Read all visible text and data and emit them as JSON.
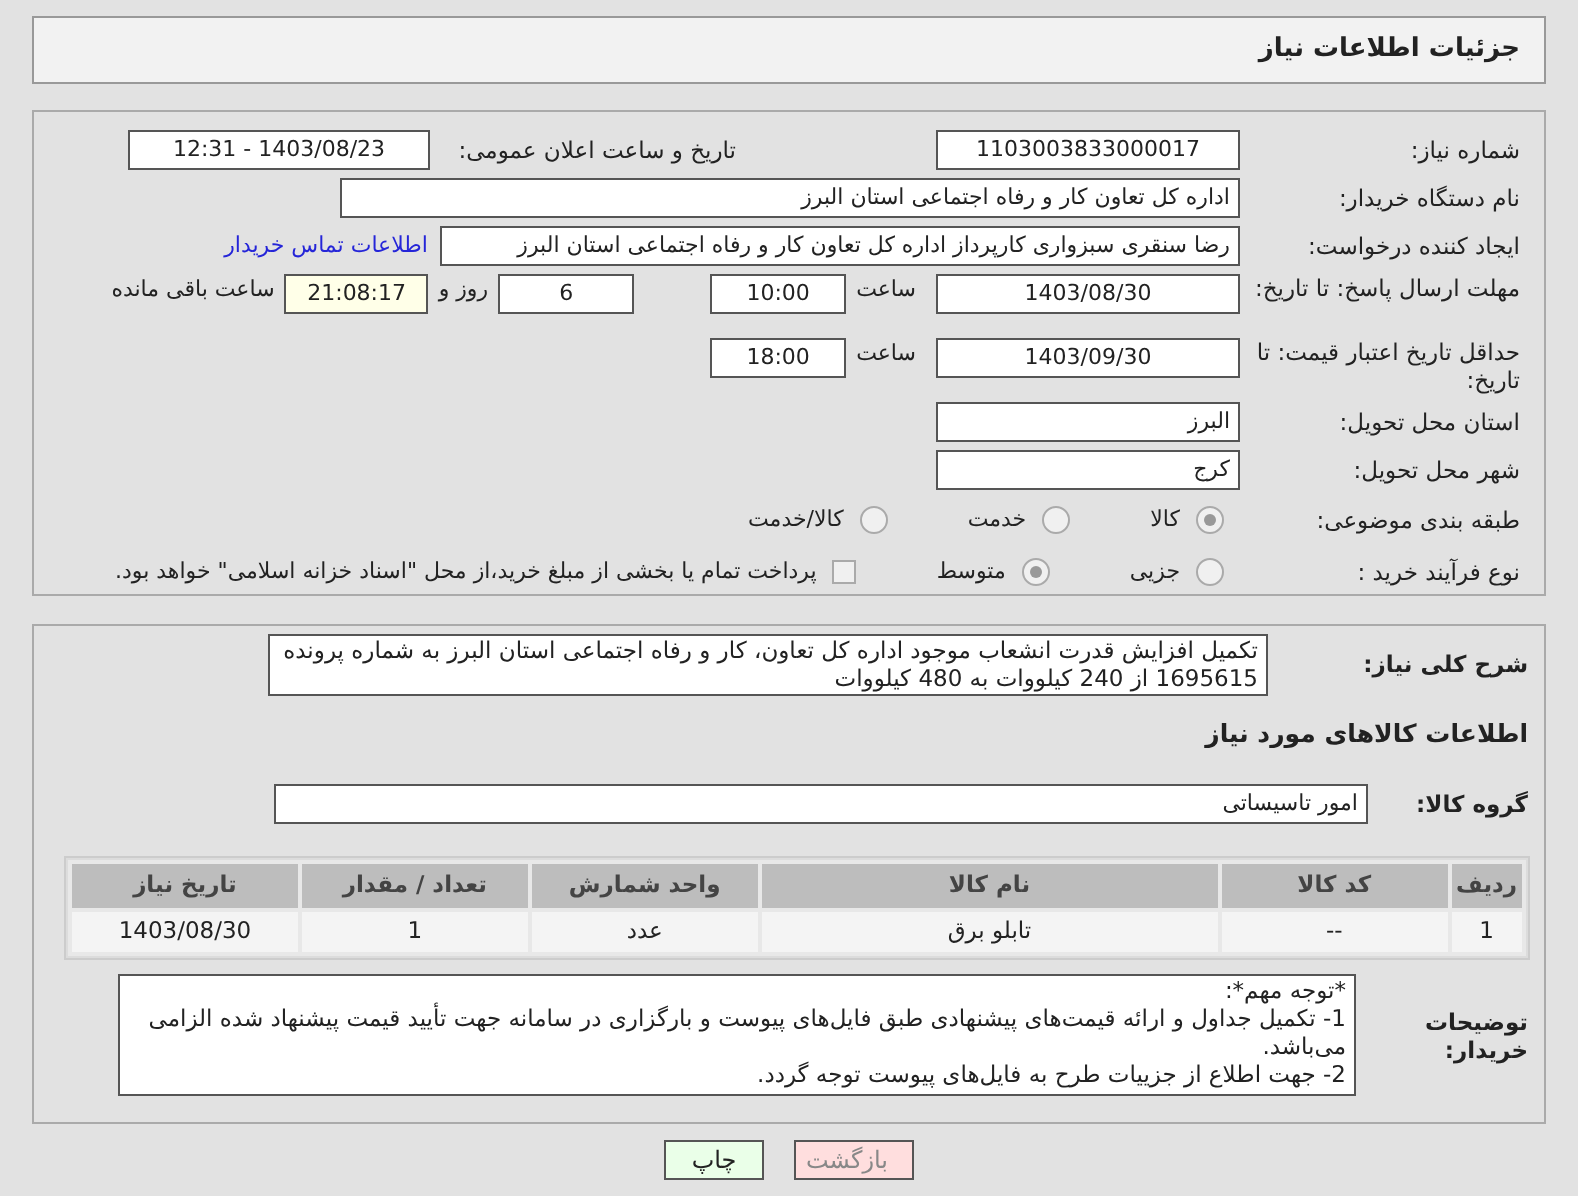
{
  "header": {
    "title": "جزئیات اطلاعات نیاز"
  },
  "need_number": {
    "label": "شماره نیاز:",
    "value": "1103003833000017"
  },
  "announce": {
    "label": "تاریخ و ساعت اعلان عمومی:",
    "value": "1403/08/23 - 12:31"
  },
  "buyer_org": {
    "label": "نام دستگاه خریدار:",
    "value": "اداره کل تعاون  کار و رفاه اجتماعی استان البرز"
  },
  "requester": {
    "label": "ایجاد کننده درخواست:",
    "value": "رضا سنقری سبزواری کارپرداز اداره کل تعاون  کار و رفاه اجتماعی استان البرز",
    "link": "اطلاعات تماس خریدار"
  },
  "reply_deadline": {
    "label": "مهلت ارسال پاسخ: تا تاریخ:",
    "date": "1403/08/30",
    "time_label": "ساعت",
    "time": "10:00",
    "days": "6",
    "days_label": "روز و",
    "remaining": "21:08:17",
    "remaining_label": "ساعت باقی مانده"
  },
  "validity": {
    "label": "حداقل تاریخ اعتبار قیمت: تا تاریخ:",
    "date": "1403/09/30",
    "time_label": "ساعت",
    "time": "18:00"
  },
  "province": {
    "label": "استان محل تحویل:",
    "value": "البرز"
  },
  "city": {
    "label": "شهر محل تحویل:",
    "value": "کرج"
  },
  "category": {
    "label": "طبقه بندی موضوعی:",
    "options": [
      {
        "label": "کالا",
        "selected": true
      },
      {
        "label": "خدمت",
        "selected": false
      },
      {
        "label": "کالا/خدمت",
        "selected": false
      }
    ]
  },
  "process": {
    "label": "نوع فرآیند خرید :",
    "options": [
      {
        "label": "جزیی",
        "selected": false
      },
      {
        "label": "متوسط",
        "selected": true
      }
    ],
    "checkbox": {
      "label": "پرداخت تمام یا بخشی از مبلغ خرید،از محل \"اسناد خزانه اسلامی\" خواهد بود.",
      "checked": false
    }
  },
  "description": {
    "label": "شرح کلی نیاز:",
    "value": "تکمیل افزایش قدرت انشعاب موجود اداره کل تعاون، کار و رفاه اجتماعی استان البرز به شماره پرونده 1695615 از 240 کیلووات به 480 کیلووات"
  },
  "goods_title": "اطلاعات کالاهای مورد نیاز",
  "goods_group": {
    "label": "گروه کالا:",
    "value": "امور تاسیساتی"
  },
  "table": {
    "columns": [
      "ردیف",
      "کد کالا",
      "نام کالا",
      "واحد شمارش",
      "تعداد / مقدار",
      "تاریخ نیاز"
    ],
    "rows": [
      [
        "1",
        "--",
        "تابلو برق",
        "عدد",
        "1",
        "1403/08/30"
      ]
    ]
  },
  "notes": {
    "label": "توضیحات خریدار:",
    "lines": [
      "*توجه مهم*:",
      "1- تکمیل جداول و ارائه قیمت‌های پیشنهادی طبق فایل‌های پیوست و بارگزاری در سامانه جهت تأیید قیمت پیشنهاد شده الزامی می‌باشد.",
      "2- جهت اطلاع از جزییات طرح به فایل‌های پیوست توجه گردد."
    ]
  },
  "buttons": [
    {
      "label": "بازگشت",
      "kind": "back"
    },
    {
      "label": "چاپ",
      "kind": "print"
    }
  ]
}
